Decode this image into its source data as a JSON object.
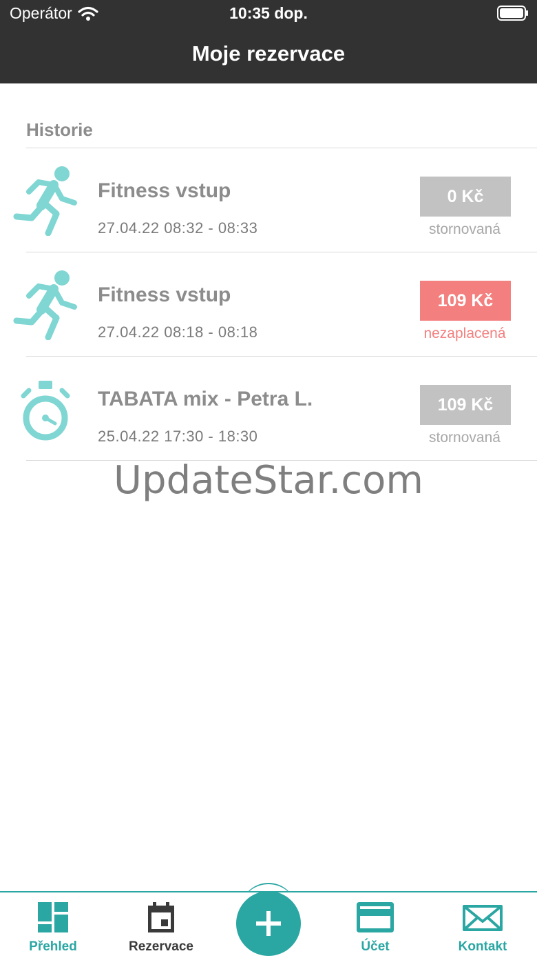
{
  "status_bar": {
    "carrier": "Operátor",
    "time": "10:35 dop."
  },
  "header": {
    "title": "Moje rezervace"
  },
  "section": {
    "title": "Historie"
  },
  "reservations": [
    {
      "icon": "running-person-icon",
      "title": "Fitness vstup",
      "date": "27.04.22 08:32 - 08:33",
      "price": "0 Kč",
      "state": "stornovaná",
      "badge_color": "#c2c2c2",
      "state_color": "#a8a8a8"
    },
    {
      "icon": "running-person-icon",
      "title": "Fitness vstup",
      "date": "27.04.22 08:18 - 08:18",
      "price": "109 Kč",
      "state": "nezaplacená",
      "badge_color": "#f47f7f",
      "state_color": "#f47f7f"
    },
    {
      "icon": "stopwatch-icon",
      "title": "TABATA mix - Petra L.",
      "date": "25.04.22 17:30 - 18:30",
      "price": "109 Kč",
      "state": "stornovaná",
      "badge_color": "#c2c2c2",
      "state_color": "#a8a8a8"
    }
  ],
  "watermark": "UpdateStar.com",
  "tabbar": {
    "items": [
      {
        "label": "Přehled",
        "icon": "dashboard-icon"
      },
      {
        "label": "Rezervace",
        "icon": "calendar-icon"
      },
      {
        "label": "Účet",
        "icon": "credit-card-icon"
      },
      {
        "label": "Kontakt",
        "icon": "envelope-icon"
      }
    ],
    "fab_icon": "plus-icon"
  },
  "colors": {
    "accent": "#2aa6a3",
    "icon_teal": "#7fd6d3",
    "header_bg": "#323232"
  }
}
